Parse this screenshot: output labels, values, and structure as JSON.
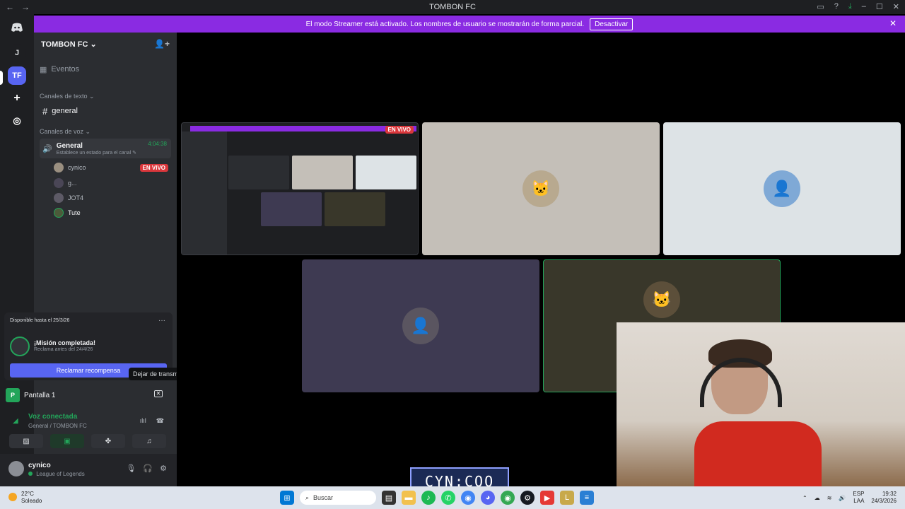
{
  "window": {
    "title": "TOMBON FC",
    "nav_back": "←",
    "nav_forward": "→"
  },
  "guilds": {
    "home_icon": "discord-icon",
    "items": [
      "J",
      "TF"
    ]
  },
  "banner": {
    "text": "El modo Streamer está activado. Los nombres de usuario se mostrarán de forma parcial.",
    "button": "Desactivar",
    "close": "✕"
  },
  "server": {
    "name": "TOMBON FC ⌄",
    "events_label": "Eventos",
    "text_category": "Canales de texto ⌄",
    "text_channel": "general",
    "voice_category": "Canales de voz ⌄",
    "voice_channel": "General",
    "voice_timer": "4:04:38",
    "voice_status": "Establece un estado para el canal ✎",
    "voice_users": [
      {
        "name": "cynico",
        "live": "EN VIVO"
      },
      {
        "name": "g..."
      },
      {
        "name": "JOT4"
      },
      {
        "name": "Tute"
      }
    ]
  },
  "quest": {
    "available_until": "Disponible hasta el 25/3/26",
    "more": "···",
    "title": "¡Misión completada!",
    "subtitle": "Reclama antes del 24/4/26",
    "button": "Reclamar recompensa"
  },
  "tooltip": {
    "text": "Dejar de transmitir"
  },
  "screen_share": {
    "label": "Pantalla 1"
  },
  "voice_panel": {
    "title": "Voz conectada",
    "subtitle": "General / TOMBON FC"
  },
  "user": {
    "name": "cynico",
    "status": "League of Legends"
  },
  "stage": {
    "live_badge": "EN VIVO"
  },
  "watermark": {
    "text": "CYN:COO"
  },
  "taskbar": {
    "weather_temp": "22°C",
    "weather_desc": "Soleado",
    "search_placeholder": "Buscar",
    "lang_top": "ESP",
    "lang_bottom": "LAA",
    "time": "19:32",
    "date": "24/3/2026"
  },
  "colors": {
    "blurple": "#5865f2",
    "green": "#23a55a",
    "red": "#da373c",
    "streamer_banner": "#8a2be2"
  }
}
